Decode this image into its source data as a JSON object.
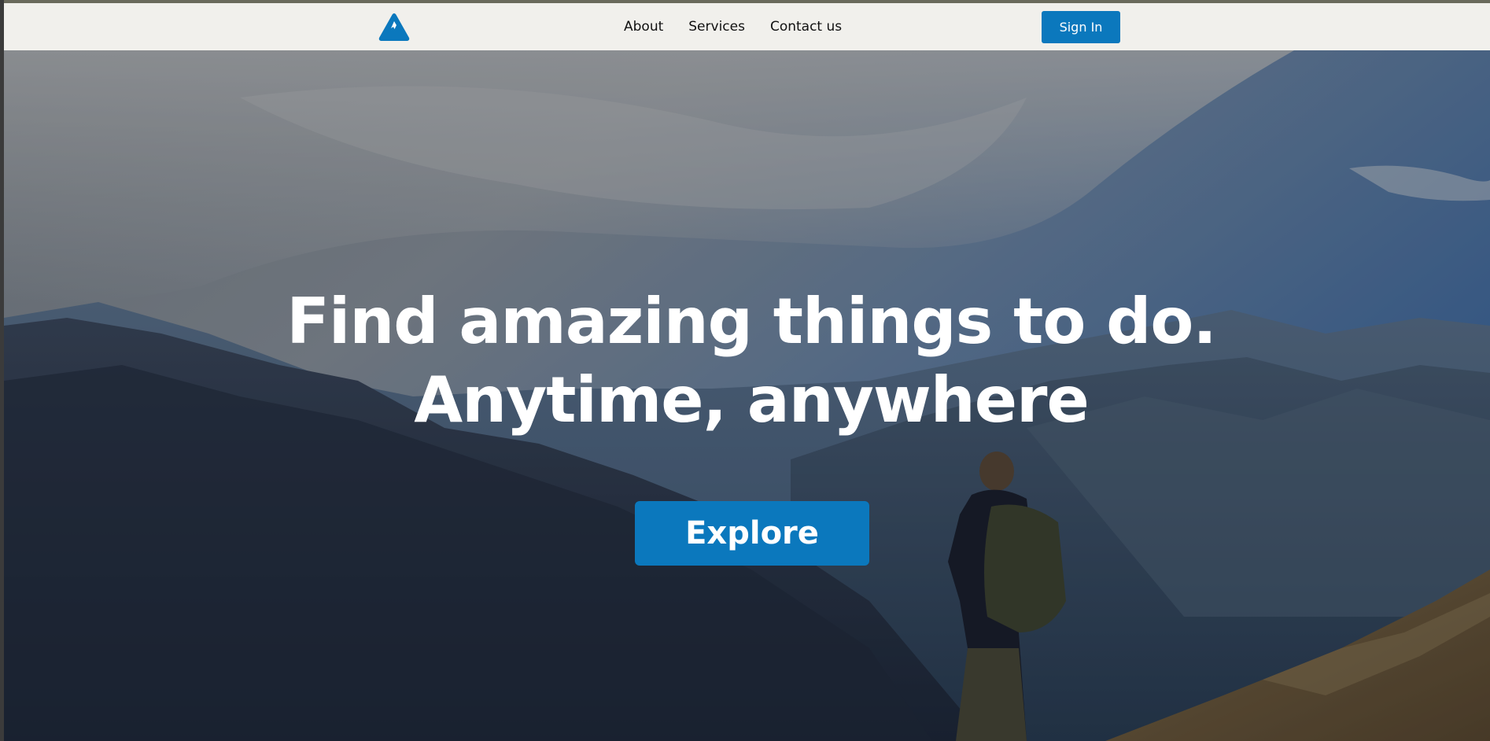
{
  "navbar": {
    "logo_icon": "mountain-triangle-icon",
    "links": [
      "About",
      "Services",
      "Contact us"
    ],
    "signin_label": "Sign In"
  },
  "hero": {
    "title_line1": "Find amazing things to do.",
    "title_line2": "Anytime, anywhere",
    "explore_label": "Explore",
    "background": "mountain-hiker-photo"
  },
  "colors": {
    "accent": "#0b78bd",
    "navbar_bg": "#f1f0ec",
    "hero_text": "#ffffff"
  }
}
